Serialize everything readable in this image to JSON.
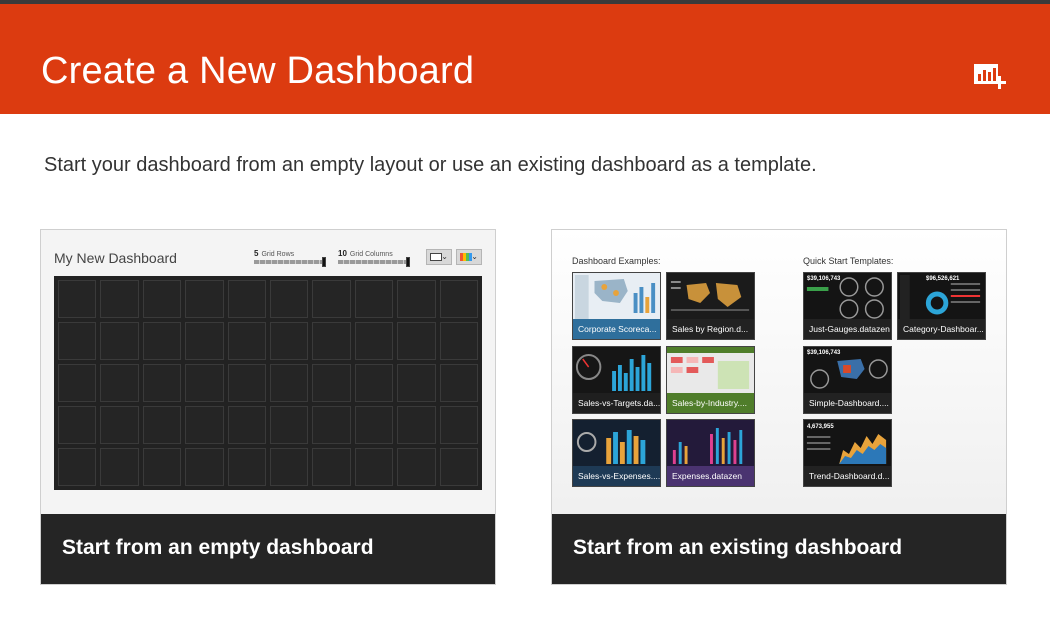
{
  "header": {
    "title": "Create a New Dashboard",
    "icon": "add-chart-icon",
    "color": "#dc3b10"
  },
  "subtitle": "Start your dashboard from an empty layout or use an existing dashboard as a template.",
  "empty_card": {
    "footer_label": "Start from an empty dashboard",
    "preview": {
      "title": "My New Dashboard",
      "rows_value": "5",
      "rows_label": "Grid Rows",
      "columns_value": "10",
      "columns_label": "Grid Columns",
      "grid_rows": 5,
      "grid_columns": 10
    }
  },
  "existing_card": {
    "footer_label": "Start from an existing dashboard",
    "examples_label": "Dashboard Examples:",
    "templates_label": "Quick Start Templates:",
    "examples": [
      {
        "label": "Corporate Scoreca..."
      },
      {
        "label": "Sales by Region.d..."
      },
      {
        "label": "Sales-vs-Targets.da..."
      },
      {
        "label": "Sales-by-Industry...."
      },
      {
        "label": "Sales-vs-Expenses...."
      },
      {
        "label": "Expenses.datazen"
      }
    ],
    "templates": [
      {
        "label": "Just-Gauges.datazen",
        "stat": "$39,106,743"
      },
      {
        "label": "Category-Dashboar...",
        "stat": "$96,526,621"
      },
      {
        "label": "Simple-Dashboard....",
        "stat": "$39,106,743"
      },
      {
        "label": "Trend-Dashboard.d...",
        "stat": "4,673,955"
      }
    ]
  }
}
